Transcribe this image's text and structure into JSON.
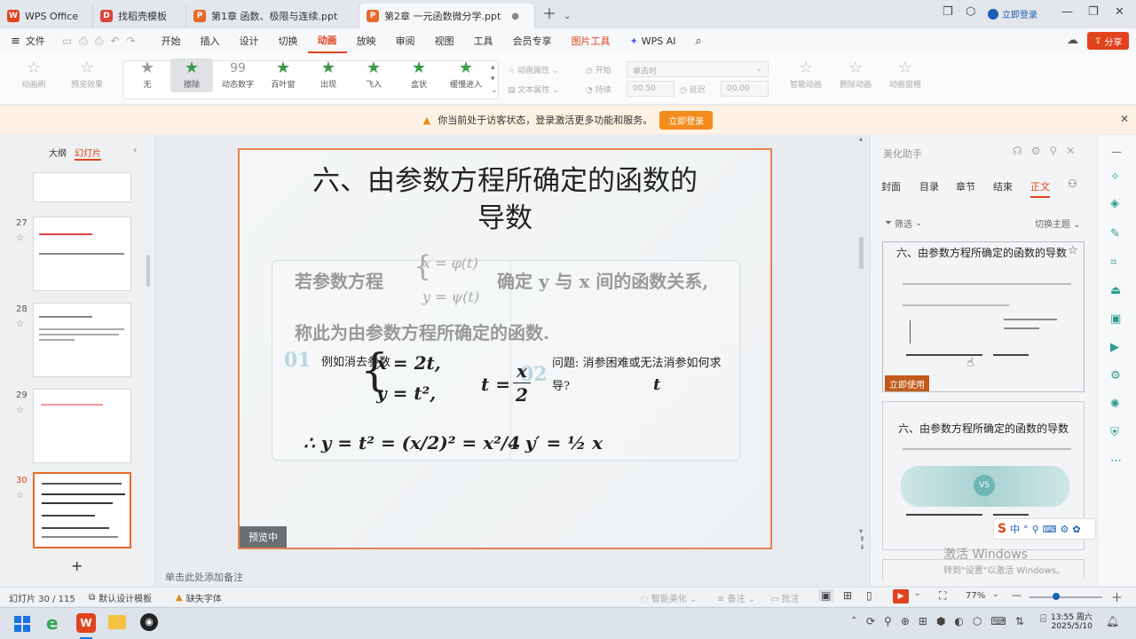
{
  "titlebar": {
    "tabs": [
      {
        "label": "WPS Office",
        "icon": "wps-icon"
      },
      {
        "label": "找稻壳模板",
        "icon": "docer-icon"
      },
      {
        "label": "第1章  函数、极限与连续.ppt",
        "icon": "ppt-icon"
      },
      {
        "label": "第2章  一元函数微分学.ppt",
        "icon": "ppt-icon"
      }
    ],
    "login": "立即登录"
  },
  "menubar": {
    "file": "文件",
    "items": [
      "开始",
      "插入",
      "设计",
      "切换",
      "动画",
      "放映",
      "审阅",
      "视图",
      "工具",
      "会员专享",
      "图片工具",
      "WPS AI"
    ],
    "share": "分享"
  },
  "ribbon": {
    "left": [
      "动画刷",
      "预览效果"
    ],
    "effects": [
      "无",
      "擦除",
      "动态数字",
      "百叶窗",
      "出现",
      "飞入",
      "盒状",
      "缓慢进入"
    ],
    "props": [
      "动画属性",
      "文本属性"
    ],
    "start_label": "开始",
    "start_value": "单击时",
    "duration_label": "持续",
    "duration_value": "00.50",
    "delay_label": "延迟",
    "delay_value": "00.00",
    "right": [
      "智能动画",
      "删除动画",
      "动画窗格"
    ]
  },
  "notice": {
    "text": "你当前处于访客状态，登录激活更多功能和服务。",
    "button": "立即登录"
  },
  "leftpanel": {
    "tabs": [
      "大纲",
      "幻灯片"
    ],
    "slides": [
      "27",
      "28",
      "29",
      "30"
    ],
    "add": "+"
  },
  "slide": {
    "title_line1": "六、由参数方程所确定的函数的",
    "title_line2": "导数",
    "para1a": "若参数方程",
    "para1b": "确定 y 与 x 间的函数关系,",
    "sys_x": "x = φ(t)",
    "sys_y": "y = ψ(t)",
    "para2": "称此为由参数方程所确定的函数.",
    "example": "例如消去参数",
    "eq_x": "x = 2t,",
    "eq_y": "y = t²,",
    "t_eq": "t =",
    "frac_num": "x",
    "frac_den": "2",
    "question": "问题: 消参困难或无法消参如何求导?",
    "t_letter": "t",
    "result1": "∴ y = t² = (x/2)² = x²/4",
    "result2": "∴ y′ = ½ x",
    "n01": "01",
    "n02": "02",
    "preview": "预览中"
  },
  "rightpanel": {
    "header": "美化助手",
    "tabs": [
      "封面",
      "目录",
      "章节",
      "结束",
      "正文"
    ],
    "filter": "筛选",
    "theme": "切换主题",
    "card1_title": "六、由参数方程所确定的函数的导数",
    "card1_btn": "立即使用",
    "card2_title": "六、由参数方程所确定的函数的导数",
    "watermark1": "激活 Windows",
    "watermark2": "转到\"设置\"以激活 Windows。"
  },
  "notes": "单击此处添加备注",
  "statusbar": {
    "slide_info": "幻灯片 30 / 115",
    "template": "默认设计模板",
    "font_missing": "缺失字体",
    "beautify": "智能美化",
    "notes": "备注",
    "comments": "批注",
    "zoom": "77%"
  },
  "taskbar": {
    "time": "13:55 周六",
    "date": "2025/5/10"
  },
  "colors": {
    "accent": "#e0431e",
    "slide_border": "#e8834e",
    "brand_orange": "#f28c1d"
  }
}
